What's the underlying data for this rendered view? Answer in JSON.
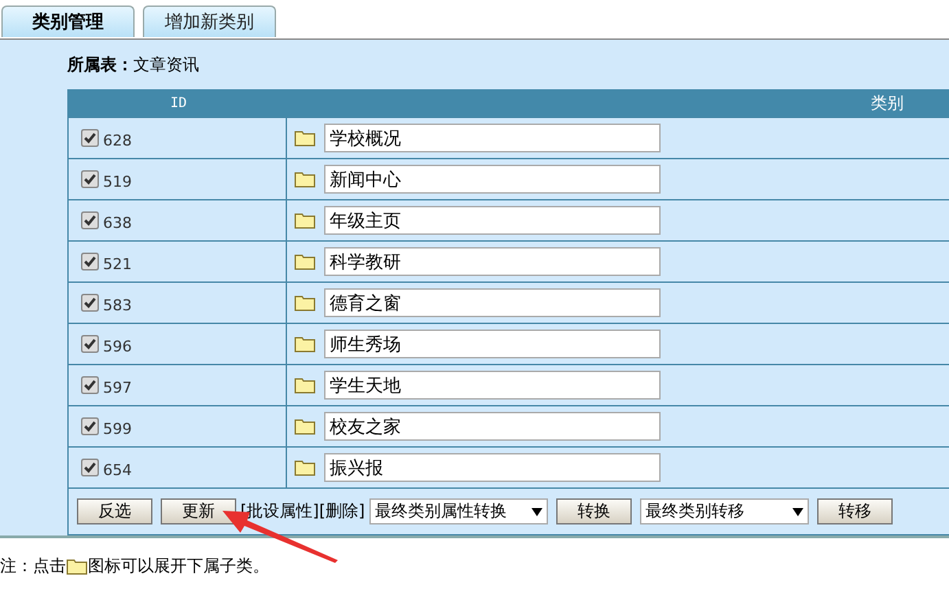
{
  "tabs": [
    {
      "label": "类别管理",
      "selected": true
    },
    {
      "label": "增加新类别",
      "selected": false
    }
  ],
  "owner": {
    "label": "所属表：",
    "value": "文章资讯"
  },
  "table": {
    "columns": [
      "ID",
      "类别"
    ],
    "rows": [
      {
        "checked": true,
        "id": "628",
        "name": "学校概况"
      },
      {
        "checked": true,
        "id": "519",
        "name": "新闻中心"
      },
      {
        "checked": true,
        "id": "638",
        "name": "年级主页"
      },
      {
        "checked": true,
        "id": "521",
        "name": "科学教研"
      },
      {
        "checked": true,
        "id": "583",
        "name": "德育之窗"
      },
      {
        "checked": true,
        "id": "596",
        "name": "师生秀场"
      },
      {
        "checked": true,
        "id": "597",
        "name": "学生天地"
      },
      {
        "checked": true,
        "id": "599",
        "name": "校友之家"
      },
      {
        "checked": true,
        "id": "654",
        "name": "振兴报"
      }
    ]
  },
  "actions": [
    {
      "kind": "button",
      "label": "反选"
    },
    {
      "kind": "button",
      "label": "更新"
    },
    {
      "kind": "link",
      "label": "[批设属性]"
    },
    {
      "kind": "link",
      "label": "[删除]"
    },
    {
      "kind": "select",
      "label": "最终类别属性转换"
    },
    {
      "kind": "button",
      "label": "转换"
    },
    {
      "kind": "select",
      "label": "最终类别转移"
    },
    {
      "kind": "button",
      "label": "转移"
    }
  ],
  "note": {
    "before": "注：点击",
    "after": "图标可以展开下属子类。"
  }
}
